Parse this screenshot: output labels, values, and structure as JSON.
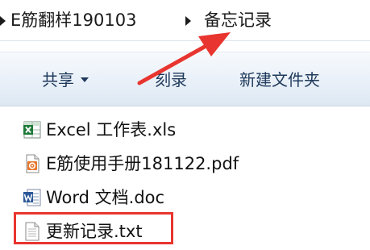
{
  "breadcrumb": {
    "items": [
      {
        "label": "E筋翻样190103"
      },
      {
        "label": "备忘记录"
      }
    ]
  },
  "toolbar": {
    "share_label": "共享",
    "burn_label": "刻录",
    "new_folder_label": "新建文件夹"
  },
  "files": [
    {
      "name": "Excel 工作表.xls",
      "icon": "excel-file-icon"
    },
    {
      "name": "E筋使用手册181122.pdf",
      "icon": "pdf-file-icon"
    },
    {
      "name": "Word 文档.doc",
      "icon": "word-file-icon"
    },
    {
      "name": "更新记录.txt",
      "icon": "text-file-icon",
      "highlighted": true
    }
  ],
  "colors": {
    "annotation_red": "#e8352f",
    "toolbar_text": "#1e395b",
    "excel_green": "#1f7a3a",
    "pdf_orange": "#e8772e",
    "word_blue": "#2b5797"
  }
}
